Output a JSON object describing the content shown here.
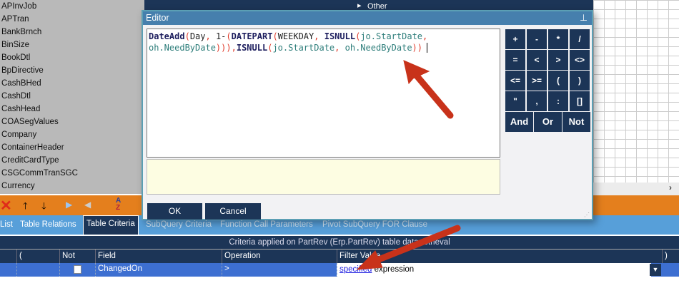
{
  "table_list": [
    "APInvJob",
    "APTran",
    "BankBrnch",
    "BinSize",
    "BookDtl",
    "BpDirective",
    "CashBHed",
    "CashDtl",
    "CashHead",
    "COASegValues",
    "Company",
    "ContainerHeader",
    "CreditCardType",
    "CSGCommTranSGC",
    "Currency"
  ],
  "background_tree_item": "Other",
  "editor": {
    "title": "Editor",
    "expression": "DateAdd(Day, 1-(DATEPART(WEEKDAY, ISNULL(jo.StartDate, oh.NeedByDate))),ISNULL(jo.StartDate, oh.NeedByDate))",
    "ok_label": "OK",
    "cancel_label": "Cancel",
    "keypad": [
      "+",
      "-",
      "*",
      "/",
      "=",
      "<",
      ">",
      "<>",
      "<=",
      ">=",
      "(",
      ")",
      "\"",
      ",",
      ":",
      "[]"
    ],
    "logic_keys": [
      "And",
      "Or",
      "Not"
    ]
  },
  "tabs": [
    "List",
    "Table Relations",
    "Table Criteria",
    "SubQuery Criteria",
    "Function Call Parameters",
    "Pivot SubQuery FOR Clause"
  ],
  "criteria_caption": "Criteria applied on PartRev (Erp.PartRev)  table data retrieval",
  "grid": {
    "headers": [
      "(",
      "Not",
      "Field",
      "Operation",
      "Filter Value",
      ")"
    ],
    "row": {
      "field": "ChangedOn",
      "operation": ">",
      "filter_link": "specified",
      "filter_text": "expression"
    }
  },
  "colors": {
    "navy": "#1c3557",
    "orange": "#e47f1d",
    "tabs_blue": "#579fd9",
    "row_blue": "#3d6fd1",
    "arrow": "#c8321a"
  }
}
